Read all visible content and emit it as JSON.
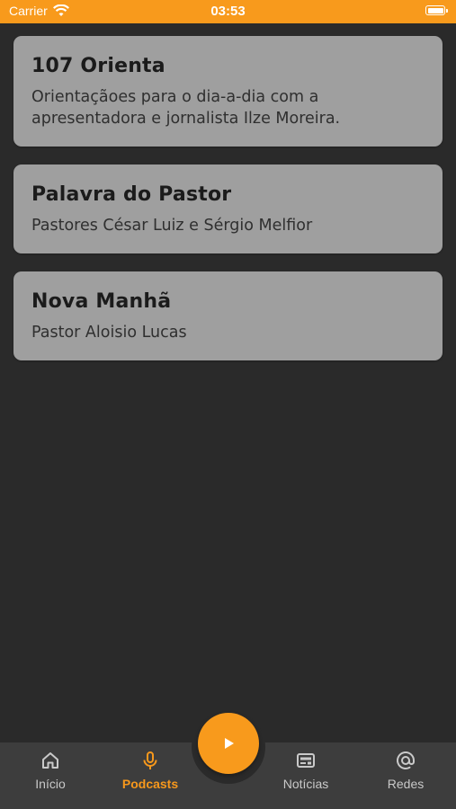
{
  "status_bar": {
    "carrier": "Carrier",
    "time": "03:53",
    "icons": [
      "wifi-icon",
      "battery-icon"
    ]
  },
  "podcasts": [
    {
      "title": "107 Orienta",
      "description": "Orientaçãoes para o dia-a-dia com a apresentadora e jornalista Ilze Moreira."
    },
    {
      "title": "Palavra do Pastor",
      "description": "Pastores César Luiz e Sérgio Melfior"
    },
    {
      "title": "Nova Manhã",
      "description": "Pastor Aloisio Lucas"
    }
  ],
  "player": {
    "icon": "play-icon"
  },
  "tabs": [
    {
      "label": "Início",
      "icon": "home-icon",
      "active": false
    },
    {
      "label": "Podcasts",
      "icon": "microphone-icon",
      "active": true
    },
    {
      "label": "Notícias",
      "icon": "news-icon",
      "active": false
    },
    {
      "label": "Redes",
      "icon": "at-icon",
      "active": false
    }
  ],
  "colors": {
    "accent": "#f89a1c",
    "background": "#2a2a2a",
    "card": "#9f9f9f",
    "tab_bar": "#3d3d3d"
  }
}
